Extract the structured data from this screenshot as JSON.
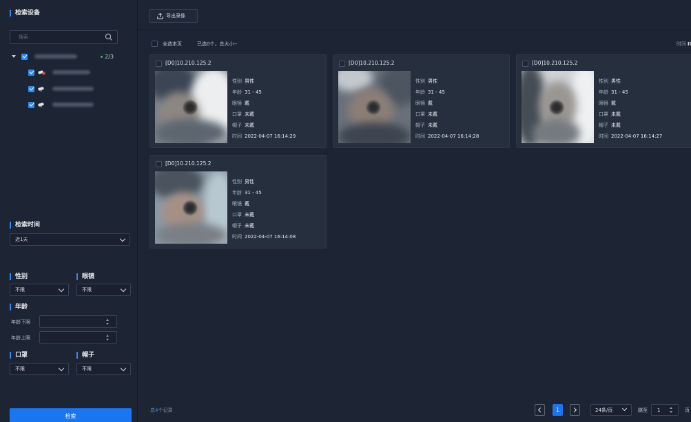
{
  "sidebar": {
    "device_title": "检索设备",
    "search_placeholder": "搜索",
    "tree": {
      "count": "2/3"
    },
    "time_title": "检索时间",
    "time_value": "近1天",
    "gender_title": "性别",
    "gender_value": "不限",
    "glasses_title": "眼镜",
    "glasses_value": "不限",
    "age_title": "年龄",
    "age_min_label": "年龄下限",
    "age_max_label": "年龄上限",
    "mask_title": "口罩",
    "mask_value": "不限",
    "hat_title": "帽子",
    "hat_value": "不限",
    "search_button": "检索"
  },
  "topbar": {
    "export_label": "导出录像"
  },
  "toolbar": {
    "select_all": "全选本页",
    "selected_info": "已选0个，总大小--",
    "time_label": "时间",
    "time_sort": "lt"
  },
  "cards": [
    {
      "title": "[D0]10.210.125.2",
      "gender_k": "性别",
      "gender_v": "男性",
      "age_k": "年龄",
      "age_v": "31 - 45",
      "glasses_k": "眼镜",
      "glasses_v": "戴",
      "mask_k": "口罩",
      "mask_v": "未戴",
      "hat_k": "帽子",
      "hat_v": "未戴",
      "time_k": "时间",
      "time_v": "2022-04-07 16:14:29"
    },
    {
      "title": "[D0]10.210.125.2",
      "gender_k": "性别",
      "gender_v": "男性",
      "age_k": "年龄",
      "age_v": "31 - 45",
      "glasses_k": "眼镜",
      "glasses_v": "戴",
      "mask_k": "口罩",
      "mask_v": "未戴",
      "hat_k": "帽子",
      "hat_v": "未戴",
      "time_k": "时间",
      "time_v": "2022-04-07 16:14:28"
    },
    {
      "title": "[D0]10.210.125.2",
      "gender_k": "性别",
      "gender_v": "男性",
      "age_k": "年龄",
      "age_v": "31 - 45",
      "glasses_k": "眼镜",
      "glasses_v": "戴",
      "mask_k": "口罩",
      "mask_v": "未戴",
      "hat_k": "帽子",
      "hat_v": "未戴",
      "time_k": "时间",
      "time_v": "2022-04-07 16:14:27"
    },
    {
      "title": "[D0]10.210.125.2",
      "gender_k": "性别",
      "gender_v": "男性",
      "age_k": "年龄",
      "age_v": "31 - 45",
      "glasses_k": "眼镜",
      "glasses_v": "戴",
      "mask_k": "口罩",
      "mask_v": "未戴",
      "hat_k": "帽子",
      "hat_v": "未戴",
      "time_k": "时间",
      "time_v": "2022-04-07 16:14:08"
    }
  ],
  "footer": {
    "total_prefix": "总",
    "total_count": "4",
    "total_suffix": "个记录",
    "current_page": "1",
    "page_size": "24条/页",
    "jump_label": "跳至",
    "jump_value": "1",
    "page_label": "页"
  },
  "colors": {
    "accent": "#1a75f0",
    "online": "#2fc25b",
    "background": "#1d2433"
  }
}
